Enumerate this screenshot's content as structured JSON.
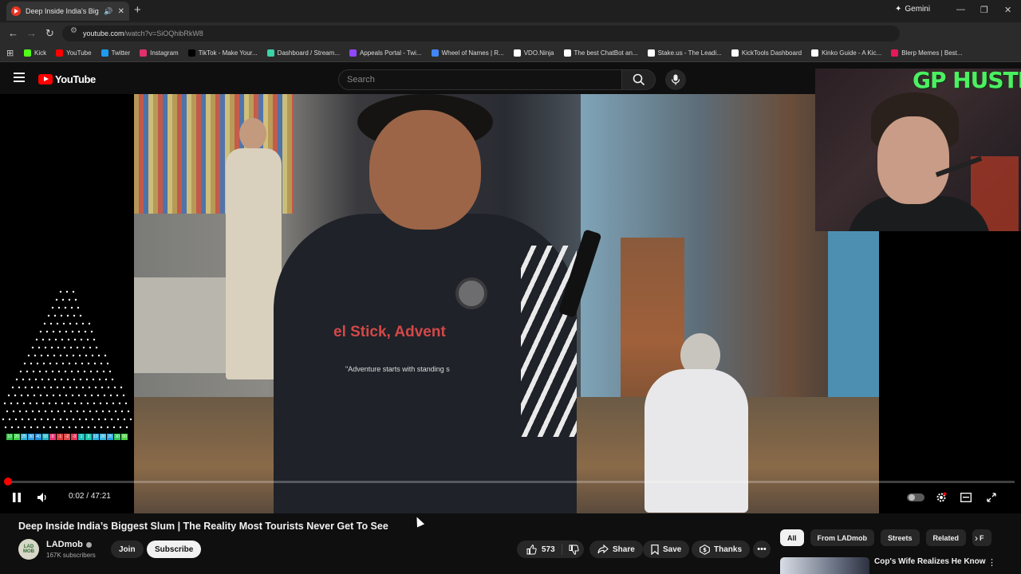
{
  "browser": {
    "tab_title": "Deep Inside India's Biggest",
    "gemini_label": "Gemini",
    "url_host": "youtube.com",
    "url_path": "/watch?v=SiOQhibRkW8",
    "bookmarks": [
      {
        "label": "Kick",
        "color": "#53fc18"
      },
      {
        "label": "YouTube",
        "color": "#ff0000"
      },
      {
        "label": "Twitter",
        "color": "#1d9bf0"
      },
      {
        "label": "Instagram",
        "color": "#e1306c"
      },
      {
        "label": "TikTok - Make Your...",
        "color": "#000000"
      },
      {
        "label": "Dashboard / Stream...",
        "color": "#3bd3a8"
      },
      {
        "label": "Appeals Portal - Twi...",
        "color": "#9146ff"
      },
      {
        "label": "Wheel of Names | R...",
        "color": "#4285f4"
      },
      {
        "label": "VDO.Ninja",
        "color": "#ffffff"
      },
      {
        "label": "The best ChatBot an...",
        "color": "#ffffff"
      },
      {
        "label": "Stake.us - The Leadi...",
        "color": "#ffffff"
      },
      {
        "label": "KickTools Dashboard",
        "color": "#ffffff"
      },
      {
        "label": "Kinko Guide - A Kic...",
        "color": "#ffffff"
      },
      {
        "label": "Blerp Memes | Best...",
        "color": "#e6195a"
      }
    ]
  },
  "header": {
    "logo_text": "YouTube",
    "search_placeholder": "Search"
  },
  "overlay": {
    "webcam_label": "GP HUSTLA",
    "color_bar_values": [
      "10",
      "20",
      "25",
      "30",
      "40",
      "50",
      "0",
      "-1",
      "-2",
      "-3",
      "1",
      "3",
      "10",
      "20",
      "25",
      "30",
      "50"
    ]
  },
  "player": {
    "time_current": "0:02",
    "time_separator": " / ",
    "time_total": "47:21",
    "progress_fraction": 0.0007,
    "shirt_text": "el Stick, Advent",
    "shirt_subtext": "\"Adventure starts with standing s",
    "accent_color": "#ff0000"
  },
  "video": {
    "title": "Deep Inside India’s Biggest Slum | The Reality Most Tourists Never Get To See",
    "channel_name": "LADmob",
    "channel_avatar_text": "LAD MOB",
    "subscribers": "167K subscribers",
    "join_label": "Join",
    "subscribe_label": "Subscribe",
    "like_count": "573",
    "share_label": "Share",
    "save_label": "Save",
    "thanks_label": "Thanks"
  },
  "sidebar": {
    "chips": [
      "All",
      "From LADmob",
      "Streets",
      "Related",
      "F"
    ],
    "recommendation_title": "Cop's Wife Realizes He Knows About Her Affair"
  }
}
